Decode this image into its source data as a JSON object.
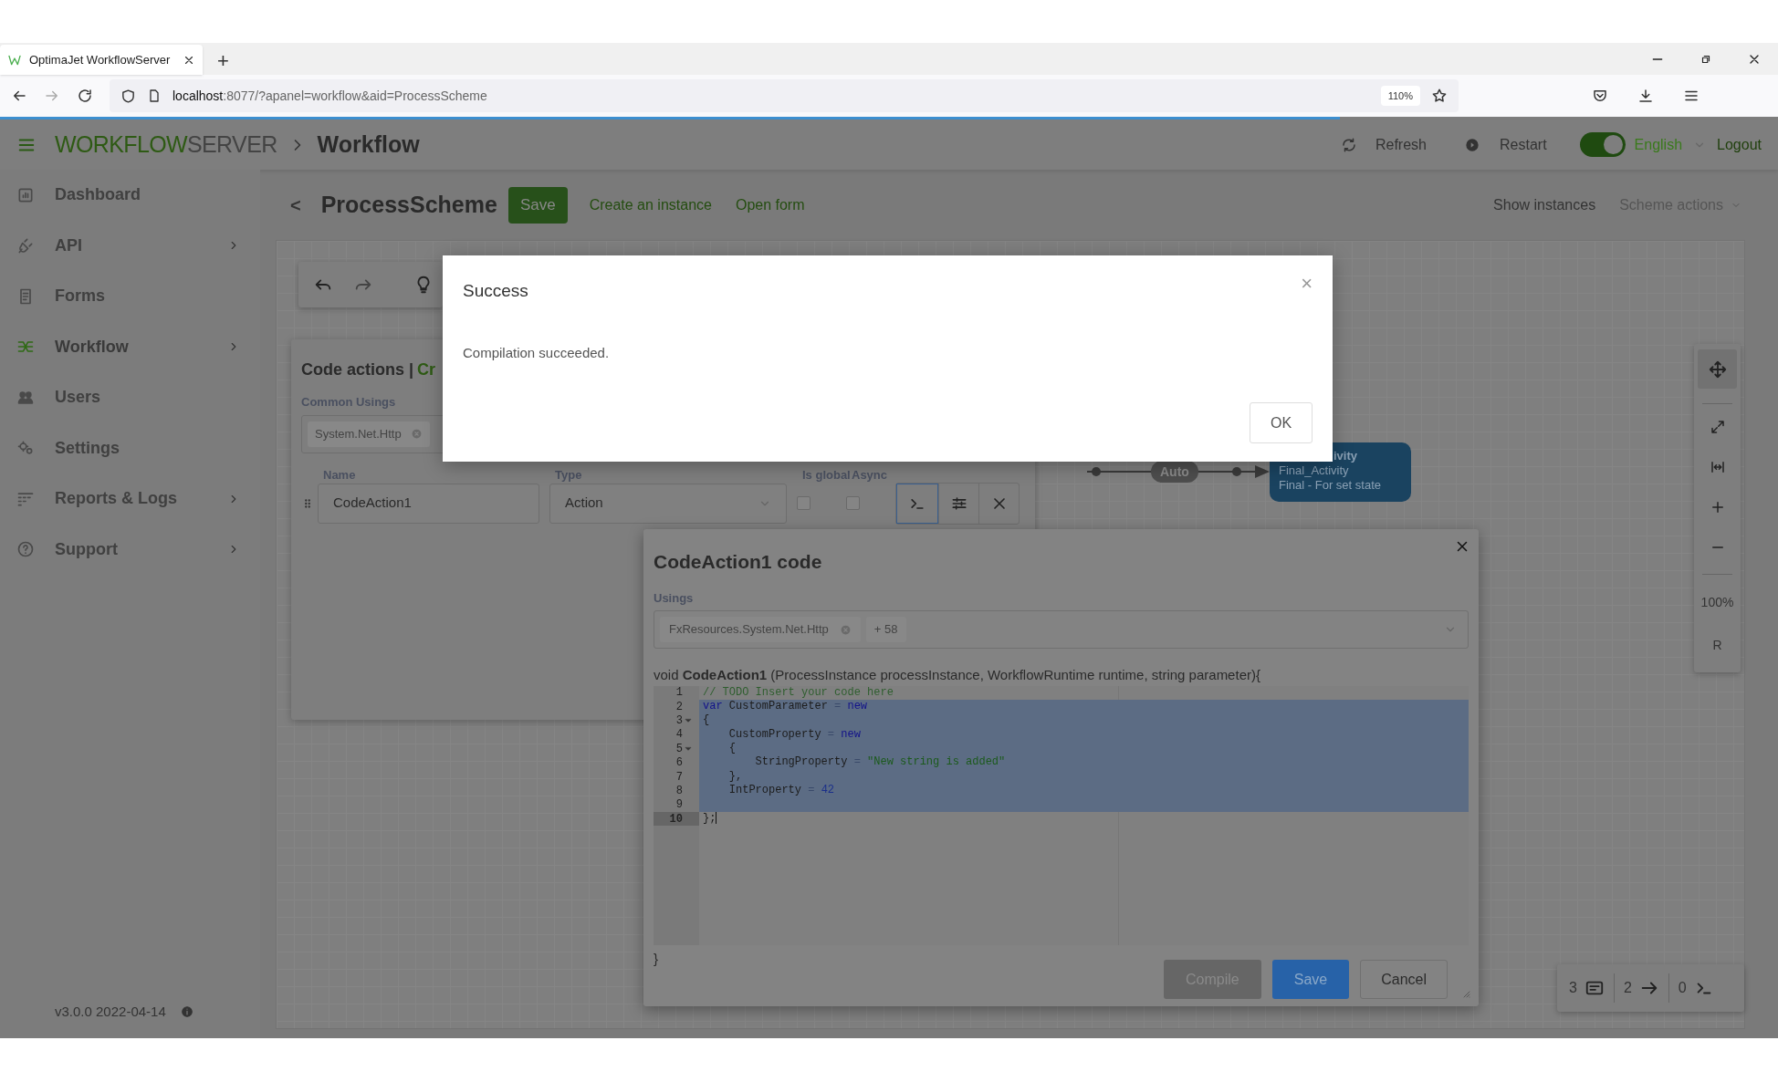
{
  "browser": {
    "tab_title": "OptimaJet WorkflowServer",
    "new_tab": "+",
    "url_host": "localhost",
    "url_rest": ":8077/?apanel=workflow&aid=ProcessScheme",
    "zoom": "110%"
  },
  "header": {
    "brand_primary": "WORKFLOW",
    "brand_secondary": "SERVER",
    "breadcrumb": "Workflow",
    "refresh": "Refresh",
    "restart": "Restart",
    "theme_toggle_on": true,
    "language": "English",
    "logout": "Logout"
  },
  "sidebar": {
    "items": [
      {
        "label": "Dashboard",
        "submenu": false,
        "selected": false
      },
      {
        "label": "API",
        "submenu": true,
        "selected": false
      },
      {
        "label": "Forms",
        "submenu": false,
        "selected": false
      },
      {
        "label": "Workflow",
        "submenu": true,
        "selected": true
      },
      {
        "label": "Users",
        "submenu": false,
        "selected": false
      },
      {
        "label": "Settings",
        "submenu": false,
        "selected": false
      },
      {
        "label": "Reports & Logs",
        "submenu": true,
        "selected": false
      },
      {
        "label": "Support",
        "submenu": true,
        "selected": false
      }
    ],
    "version": "v3.0.0 2022-04-14"
  },
  "page_header": {
    "back": "<",
    "title": "ProcessScheme",
    "save": "Save",
    "links": [
      "Create an instance",
      "Open form"
    ],
    "show_instances": "Show instances",
    "scheme_actions": "Scheme actions",
    "scheme_actions_disabled": true
  },
  "code_actions": {
    "title": "Code actions |",
    "title_accent": "Cr",
    "common_usings_label": "Common Usings",
    "common_usings": [
      "System.Net.Http"
    ],
    "columns": [
      "Name",
      "Type",
      "Is global",
      "Async"
    ],
    "rows": [
      {
        "name": "CodeAction1",
        "type": "Action",
        "is_global": false,
        "async": false
      }
    ]
  },
  "graph": {
    "edge_label": "Auto",
    "node_lines": [
      "ivity",
      "Final_Activity",
      "Final - For set state"
    ]
  },
  "zoom_panel": {
    "level": "100%",
    "reset": "R"
  },
  "counters": [
    {
      "kind": "activities",
      "count": "3"
    },
    {
      "kind": "transitions",
      "count": "2"
    },
    {
      "kind": "actions",
      "count": "0"
    }
  ],
  "code_dialog": {
    "title": "CodeAction1 code",
    "usings_label": "Usings",
    "usings": [
      "FxResources.System.Net.Http"
    ],
    "usings_more": "+ 58",
    "signature": "void **CodeAction1** (ProcessInstance processInstance, WorkflowRuntime runtime, string parameter){",
    "lines": [
      {
        "number": "1",
        "selected": false,
        "active": false,
        "foldable": false,
        "tokens": [
          {
            "kind": "comment",
            "text": "// TODO Insert your code here"
          }
        ]
      },
      {
        "number": "2",
        "selected": true,
        "active": false,
        "foldable": false,
        "tokens": [
          {
            "kind": "keyword",
            "text": "var"
          },
          {
            "kind": "plain",
            "text": " CustomParameter"
          },
          {
            "kind": "operator",
            "text": " = "
          },
          {
            "kind": "keyword",
            "text": "new"
          }
        ]
      },
      {
        "number": "3",
        "selected": true,
        "active": false,
        "foldable": true,
        "tokens": [
          {
            "kind": "plain",
            "text": "{"
          }
        ]
      },
      {
        "number": "4",
        "selected": true,
        "active": false,
        "foldable": false,
        "tokens": [
          {
            "kind": "plain",
            "text": "    CustomProperty"
          },
          {
            "kind": "operator",
            "text": " = "
          },
          {
            "kind": "keyword",
            "text": "new"
          }
        ]
      },
      {
        "number": "5",
        "selected": true,
        "active": false,
        "foldable": true,
        "tokens": [
          {
            "kind": "plain",
            "text": "    {"
          }
        ]
      },
      {
        "number": "6",
        "selected": true,
        "active": false,
        "foldable": false,
        "tokens": [
          {
            "kind": "plain",
            "text": "        StringProperty"
          },
          {
            "kind": "operator",
            "text": " = "
          },
          {
            "kind": "string",
            "text": "\"New string is added\""
          }
        ]
      },
      {
        "number": "7",
        "selected": true,
        "active": false,
        "foldable": false,
        "tokens": [
          {
            "kind": "plain",
            "text": "    },"
          }
        ]
      },
      {
        "number": "8",
        "selected": true,
        "active": false,
        "foldable": false,
        "tokens": [
          {
            "kind": "plain",
            "text": "    IntProperty"
          },
          {
            "kind": "operator",
            "text": " = "
          },
          {
            "kind": "number",
            "text": "42"
          }
        ]
      },
      {
        "number": "9",
        "selected": true,
        "active": false,
        "foldable": false
      },
      {
        "number": "10",
        "selected": false,
        "active": true,
        "foldable": false,
        "tokens": [
          {
            "kind": "plain",
            "text": "};"
          }
        ]
      }
    ],
    "closing": "}",
    "compile": "Compile",
    "compile_disabled": true,
    "save": "Save",
    "cancel": "Cancel"
  },
  "success_dialog": {
    "title": "Success",
    "message": "Compilation succeeded.",
    "ok": "OK",
    "close": "×"
  }
}
